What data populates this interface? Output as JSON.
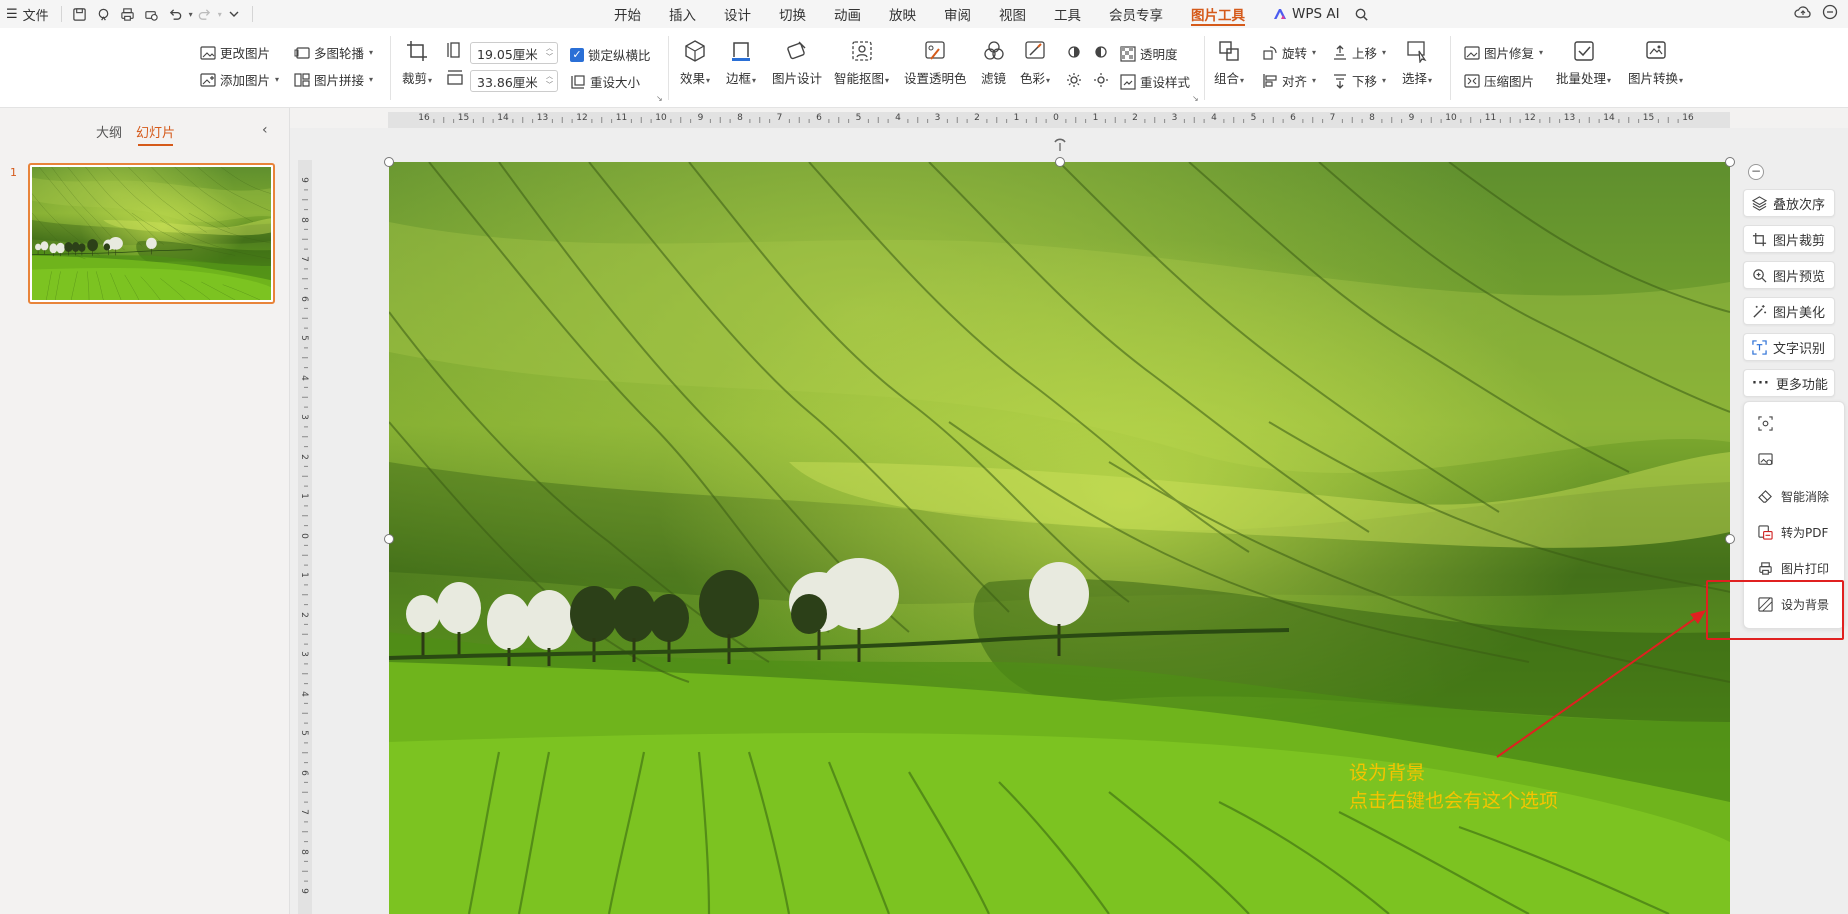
{
  "menubar": {
    "file_label": "文件",
    "tabs": [
      "开始",
      "插入",
      "设计",
      "切换",
      "动画",
      "放映",
      "审阅",
      "视图",
      "工具",
      "会员专享",
      "图片工具"
    ],
    "active_tab": "图片工具",
    "wps_ai_label": "WPS AI"
  },
  "ribbon": {
    "change_picture": "更改图片",
    "add_picture": "添加图片",
    "multi_carousel": "多图轮播",
    "picture_stitch": "图片拼接",
    "crop": "裁剪",
    "height_value": "19.05厘米",
    "width_value": "33.86厘米",
    "lock_ratio": "锁定纵横比",
    "reset_size": "重设大小",
    "effects": "效果",
    "border": "边框",
    "picture_design": "图片设计",
    "smart_cutout": "智能抠图",
    "set_transparent": "设置透明色",
    "filter": "滤镜",
    "color": "色彩",
    "transparency": "透明度",
    "reset_style": "重设样式",
    "group": "组合",
    "rotate": "旋转",
    "align": "对齐",
    "bring_forward": "上移",
    "send_backward": "下移",
    "select": "选择",
    "picture_repair": "图片修复",
    "compress_picture": "压缩图片",
    "batch_process": "批量处理",
    "picture_convert": "图片转换"
  },
  "left_panel": {
    "tab_outline": "大纲",
    "tab_slides": "幻灯片",
    "slide_number": "1"
  },
  "rulers": {
    "h_ticks": [
      "16",
      "15",
      "14",
      "13",
      "12",
      "11",
      "10",
      "9",
      "8",
      "7",
      "6",
      "5",
      "4",
      "3",
      "2",
      "1",
      "0",
      "1",
      "2",
      "3",
      "4",
      "5",
      "6",
      "7",
      "8",
      "9",
      "10",
      "11",
      "12",
      "13",
      "14",
      "15",
      "16"
    ],
    "v_ticks": [
      "9",
      "8",
      "7",
      "6",
      "5",
      "4",
      "3",
      "2",
      "1",
      "0",
      "1",
      "2",
      "3",
      "4",
      "5",
      "6",
      "7",
      "8",
      "9"
    ]
  },
  "side_panel": {
    "buttons": [
      "叠放次序",
      "图片裁剪",
      "图片预览",
      "图片美化",
      "文字识别",
      "更多功能"
    ],
    "more_items": [
      "智能消除",
      "转为PDF",
      "图片打印",
      "设为背景"
    ]
  },
  "annotation": {
    "line1": "设为背景",
    "line2": "点击右键也会有这个选项",
    "color": "#f5c400",
    "highlight_color": "#e02020"
  },
  "colors": {
    "accent": "#d55a1a",
    "checkbox": "#2a6fd6"
  }
}
